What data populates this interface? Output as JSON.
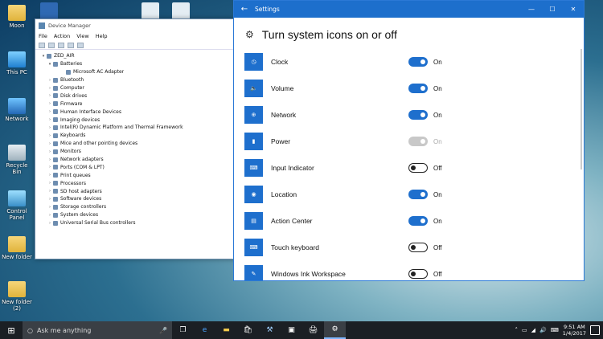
{
  "desktop": {
    "icons": [
      {
        "label": "Moon"
      },
      {
        "label": "This PC"
      },
      {
        "label": "Network"
      },
      {
        "label": "Recycle Bin"
      },
      {
        "label": "Control Panel"
      },
      {
        "label": "New folder"
      },
      {
        "label": "New folder (2)"
      }
    ]
  },
  "device_manager": {
    "title": "Device Manager",
    "menu": [
      "File",
      "Action",
      "View",
      "Help"
    ],
    "tree": [
      {
        "label": "ZED_AIR",
        "level": 0
      },
      {
        "label": "Batteries",
        "level": 1
      },
      {
        "label": "Microsoft AC Adapter",
        "level": 2
      },
      {
        "label": "Bluetooth",
        "level": 1
      },
      {
        "label": "Computer",
        "level": 1
      },
      {
        "label": "Disk drives",
        "level": 1
      },
      {
        "label": "Firmware",
        "level": 1
      },
      {
        "label": "Human Interface Devices",
        "level": 1
      },
      {
        "label": "Imaging devices",
        "level": 1
      },
      {
        "label": "Intel(R) Dynamic Platform and Thermal Framework",
        "level": 1
      },
      {
        "label": "Keyboards",
        "level": 1
      },
      {
        "label": "Mice and other pointing devices",
        "level": 1
      },
      {
        "label": "Monitors",
        "level": 1
      },
      {
        "label": "Network adapters",
        "level": 1
      },
      {
        "label": "Ports (COM & LPT)",
        "level": 1
      },
      {
        "label": "Print queues",
        "level": 1
      },
      {
        "label": "Processors",
        "level": 1
      },
      {
        "label": "SD host adapters",
        "level": 1
      },
      {
        "label": "Software devices",
        "level": 1
      },
      {
        "label": "Storage controllers",
        "level": 1
      },
      {
        "label": "System devices",
        "level": 1
      },
      {
        "label": "Universal Serial Bus controllers",
        "level": 1
      }
    ]
  },
  "settings": {
    "window_title": "Settings",
    "heading": "Turn system icons on or off",
    "items": [
      {
        "label": "Clock",
        "state": "On",
        "mode": "on",
        "icon": "clock-icon"
      },
      {
        "label": "Volume",
        "state": "On",
        "mode": "on",
        "icon": "volume-icon"
      },
      {
        "label": "Network",
        "state": "On",
        "mode": "on",
        "icon": "network-icon"
      },
      {
        "label": "Power",
        "state": "On",
        "mode": "disabled",
        "icon": "power-icon"
      },
      {
        "label": "Input Indicator",
        "state": "Off",
        "mode": "off",
        "icon": "input-indicator-icon"
      },
      {
        "label": "Location",
        "state": "On",
        "mode": "on",
        "icon": "location-icon"
      },
      {
        "label": "Action Center",
        "state": "On",
        "mode": "on",
        "icon": "action-center-icon"
      },
      {
        "label": "Touch keyboard",
        "state": "Off",
        "mode": "off",
        "icon": "keyboard-icon"
      },
      {
        "label": "Windows Ink Workspace",
        "state": "Off",
        "mode": "off",
        "icon": "pen-icon"
      }
    ]
  },
  "taskbar": {
    "search_placeholder": "Ask me anything",
    "time": "9:51 AM",
    "date": "1/4/2017"
  },
  "colors": {
    "accent": "#1e6fcd",
    "taskbar": "#1b1f24"
  }
}
